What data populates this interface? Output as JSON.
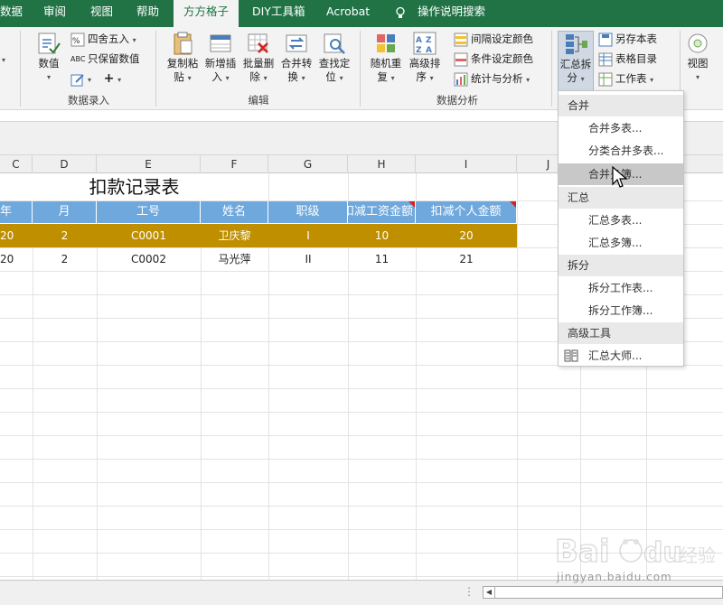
{
  "tabs": [
    {
      "label": "数据",
      "active": false
    },
    {
      "label": "审阅",
      "active": false
    },
    {
      "label": "视图",
      "active": false
    },
    {
      "label": "帮助",
      "active": false
    },
    {
      "label": "方方格子",
      "active": true
    },
    {
      "label": "DIY工具箱",
      "active": false
    },
    {
      "label": "Acrobat",
      "active": false
    },
    {
      "label": "操作说明搜索",
      "active": false
    }
  ],
  "ribbon": {
    "group1_label": "数据录入",
    "group2_label": "编辑",
    "group3_label": "数据分析",
    "value_btn": "数值",
    "round_btn": "四舍五入",
    "keep_value_btn": "只保留数值",
    "copy_paste": [
      "复制粘",
      "贴"
    ],
    "insert_new": [
      "新增插",
      "入"
    ],
    "batch_delete": [
      "批量删",
      "除"
    ],
    "merge_convert": [
      "合并转",
      "换"
    ],
    "find_locate": [
      "查找定",
      "位"
    ],
    "random_repeat": [
      "随机重",
      "复"
    ],
    "advanced_sort": [
      "高级排",
      "序"
    ],
    "interval_color": "间隔设定颜色",
    "cond_color": "条件设定颜色",
    "stats_analysis": "统计与分析",
    "summary_split": [
      "汇总拆",
      "分"
    ],
    "save_sheet": "另存本表",
    "table_dir": "表格目录",
    "worksheet": "工作表",
    "view_btn": "视图"
  },
  "columns": [
    "C",
    "D",
    "E",
    "F",
    "G",
    "H",
    "I",
    "J"
  ],
  "sheet": {
    "title": "扣款记录表",
    "headers": [
      "年",
      "月",
      "工号",
      "姓名",
      "职级",
      "扣减工资金额",
      "扣减个人金额"
    ],
    "rows": [
      [
        "20",
        "2",
        "C0001",
        "卫庆黎",
        "I",
        "10",
        "20"
      ],
      [
        "20",
        "2",
        "C0002",
        "马光萍",
        "II",
        "11",
        "21"
      ]
    ]
  },
  "dropdown": {
    "sections": [
      {
        "title": "合并",
        "items": [
          "合并多表...",
          "分类合并多表...",
          "合并多簿..."
        ]
      },
      {
        "title": "汇总",
        "items": [
          "汇总多表...",
          "汇总多簿..."
        ]
      },
      {
        "title": "拆分",
        "items": [
          "拆分工作表...",
          "拆分工作簿..."
        ]
      },
      {
        "title": "高级工具",
        "items": [
          "汇总大师..."
        ]
      }
    ]
  },
  "watermark": {
    "text": "jingyan.baidu.com",
    "logo": "Baidu 经验"
  },
  "colors": {
    "excel_green": "#217346",
    "header_blue": "#6fa8dc",
    "row_gold": "#bf8f00"
  }
}
